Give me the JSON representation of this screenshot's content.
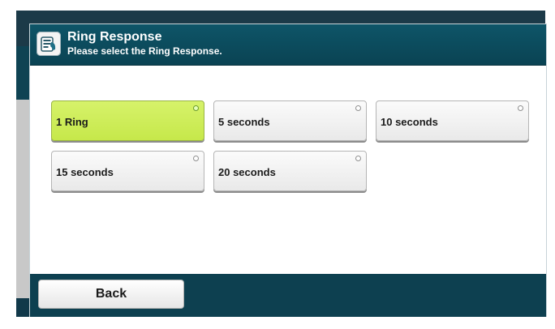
{
  "dialog": {
    "title": "Ring Response",
    "subtitle": "Please select the Ring Response.",
    "icon": "phone-handset-icon"
  },
  "options": [
    {
      "label": "1 Ring",
      "selected": true
    },
    {
      "label": "5 seconds",
      "selected": false
    },
    {
      "label": "10 seconds",
      "selected": false
    },
    {
      "label": "15 seconds",
      "selected": false
    },
    {
      "label": "20 seconds",
      "selected": false
    }
  ],
  "footer": {
    "back_label": "Back"
  },
  "colors": {
    "header": "#0e5568",
    "selected_option": "#cdee55",
    "footer": "#0d4050"
  }
}
